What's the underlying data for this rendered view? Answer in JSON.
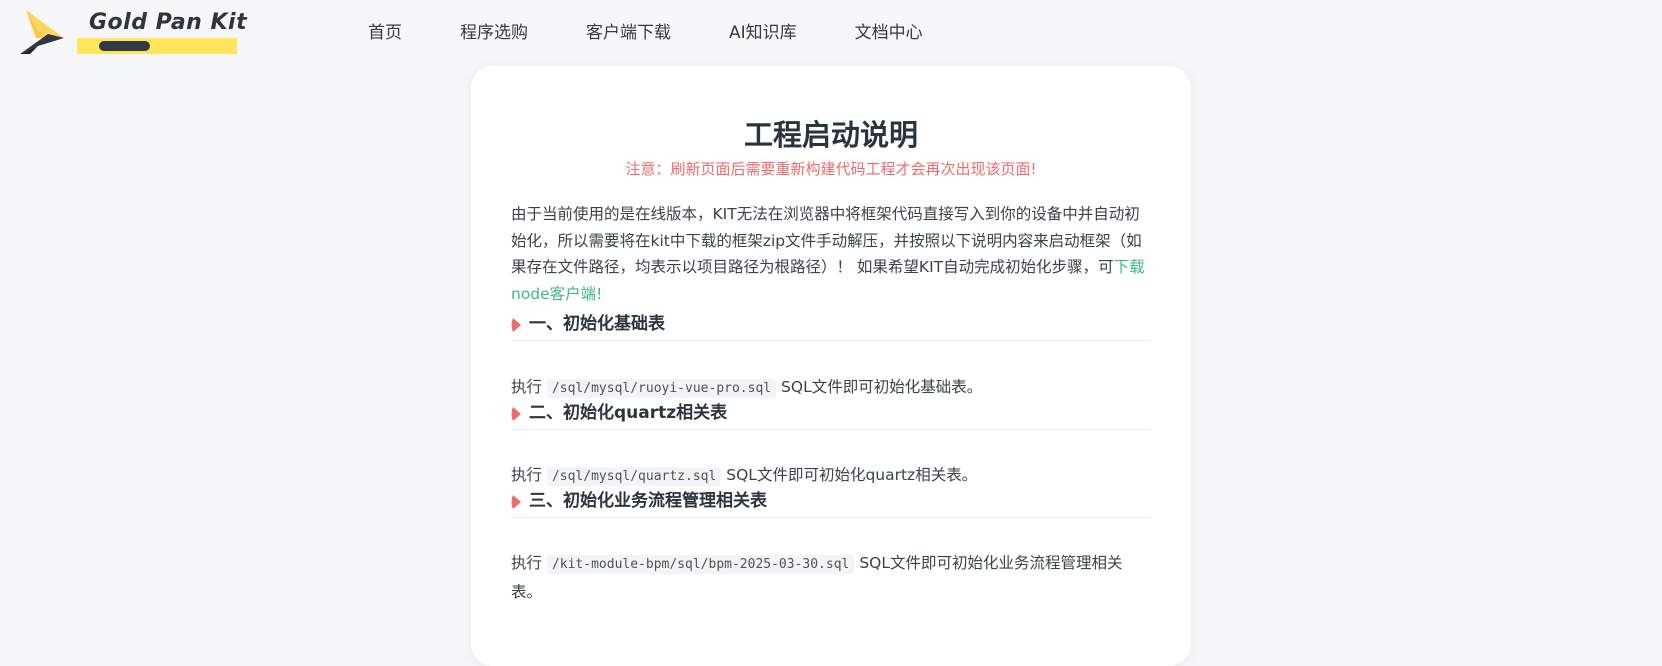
{
  "brand": {
    "name": "Gold Pan Kit",
    "accent": "#ffe45c"
  },
  "nav": {
    "items": [
      {
        "label": "首页"
      },
      {
        "label": "程序选购"
      },
      {
        "label": "客户端下载"
      },
      {
        "label": "AI知识库"
      },
      {
        "label": "文档中心"
      }
    ]
  },
  "doc": {
    "title": "工程启动说明",
    "notice": "注意：刷新页面后需要重新构建代码工程才会再次出现该页面!",
    "intro_text": "由于当前使用的是在线版本，KIT无法在浏览器中将框架代码直接写入到你的设备中并自动初始化，所以需要将在kit中下载的框架zip文件手动解压，并按照以下说明内容来启动框架（如果存在文件路径，均表示以项目路径为根路径）！ 如果希望KIT自动完成初始化步骤，可",
    "download_link": "下载node客户端!",
    "sections": [
      {
        "title": "一、初始化基础表",
        "prefix": "执行",
        "code": "/sql/mysql/ruoyi-vue-pro.sql",
        "suffix": "SQL文件即可初始化基础表。"
      },
      {
        "title": "二、初始化quartz相关表",
        "prefix": "执行",
        "code": "/sql/mysql/quartz.sql",
        "suffix": "SQL文件即可初始化quartz相关表。"
      },
      {
        "title": "三、初始化业务流程管理相关表",
        "prefix": "执行",
        "code": "/kit-module-bpm/sql/bpm-2025-03-30.sql",
        "suffix": "SQL文件即可初始化业务流程管理相关表。"
      }
    ]
  },
  "colors": {
    "notice": "#ef6b6b",
    "link": "#41b883",
    "marker": "#ef6b6b"
  }
}
